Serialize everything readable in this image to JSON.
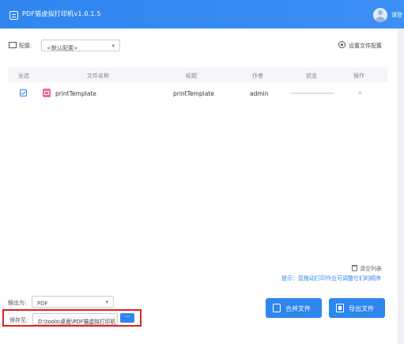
{
  "titlebar": {
    "app_title": "PDF猫虚拟打印机v1.0.1.5",
    "login": "请登",
    "color": "#2f86ef"
  },
  "config": {
    "label": "配置:",
    "selected": "<默认配置>",
    "settings_link": "设置文件配置"
  },
  "table": {
    "headers": {
      "select_all": "全选",
      "file_name": "文件名称",
      "title": "标题",
      "author": "作者",
      "status": "状态",
      "action": "操作"
    },
    "rows": [
      {
        "checked": true,
        "file_name": "printTemplate",
        "title": "printTemplate",
        "author": "admin",
        "progress": 0,
        "action": "×"
      }
    ]
  },
  "footer": {
    "clear_list": "清空列表",
    "hint": "提示：您拖动打印作业可调整它们的顺序",
    "output_label": "输出为:",
    "output_format": "PDF",
    "save_label": "保存至:",
    "save_path": "D:\\tools\\桌面\\PDF猫虚拟打印机",
    "browse": "···",
    "merge_button": "合并文件",
    "export_button": "导出文件"
  },
  "icons": [
    "app-icon",
    "avatar-icon",
    "config-icon",
    "gear-icon",
    "pdf-file-icon",
    "trash-icon",
    "merge-icon",
    "export-icon"
  ]
}
